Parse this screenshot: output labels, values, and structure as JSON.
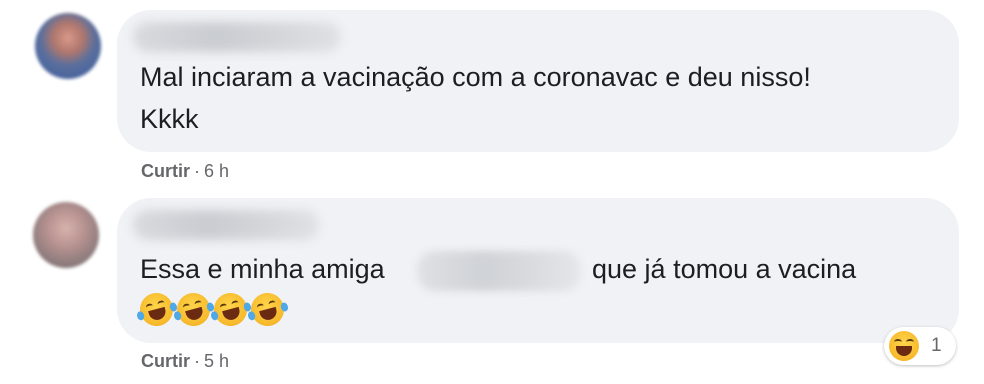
{
  "comments": [
    {
      "text_line1": "Mal inciaram a vacinação com a coronavac e deu nisso!",
      "text_line2": "Kkkk",
      "like_label": "Curtir",
      "separator": "·",
      "time": "6 h"
    },
    {
      "text_before": "Essa e minha amiga",
      "text_after": "que já tomou a vacina",
      "emojis": [
        "rolling-on-floor-laughing",
        "rolling-on-floor-laughing",
        "rolling-on-floor-laughing",
        "rolling-on-floor-laughing"
      ],
      "like_label": "Curtir",
      "separator": "·",
      "time": "5 h",
      "reaction": {
        "icon": "haha-reaction",
        "count": "1"
      }
    }
  ],
  "colors": {
    "bubble": "#f0f2f5",
    "meta_text": "#65676b",
    "body_text": "#1c1e21"
  }
}
